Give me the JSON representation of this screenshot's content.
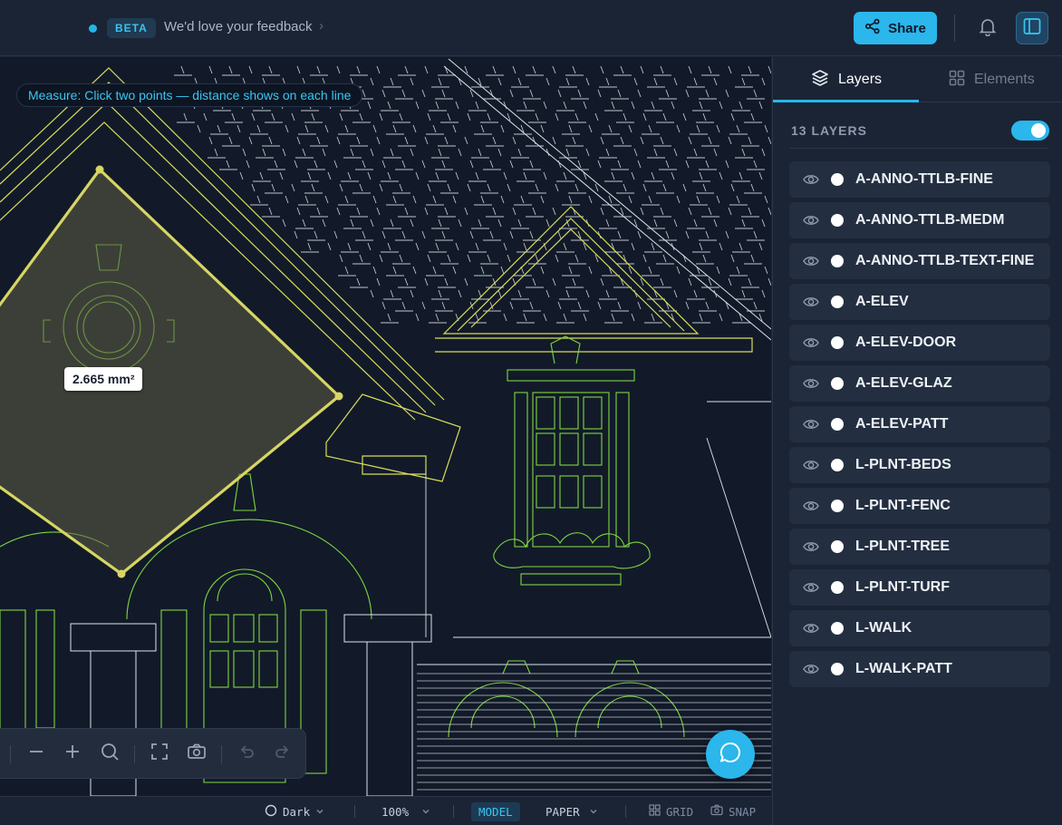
{
  "header": {
    "beta_badge": "BETA",
    "feedback_text": "We'd love your feedback",
    "feedback_chevron": "›",
    "share_label": "Share",
    "icons": {
      "share": "share-icon",
      "bell": "bell-icon",
      "panel": "panel-toggle-icon"
    },
    "colors": {
      "accent": "#2bb6ec"
    }
  },
  "canvas": {
    "measure_hint": "Measure: Click two points — distance shows on each line",
    "area_label": "2.665 mm²",
    "drawing_colors": {
      "lines": "#e6e6e6",
      "green": "#7fd640",
      "yellow": "#d8dc5a",
      "measure": "#d7d563"
    },
    "toolbar_icons": [
      "zoom-out-icon",
      "zoom-in-icon",
      "search-icon",
      "fit-screen-icon",
      "camera-icon",
      "undo-icon",
      "redo-icon"
    ]
  },
  "statusbar": {
    "theme": "Dark",
    "zoom": "100%",
    "model": "MODEL",
    "paper": "PAPER",
    "grid": "GRID",
    "snap": "SNAP"
  },
  "panel": {
    "tabs": [
      {
        "label": "Layers",
        "icon": "layers-icon",
        "active": true
      },
      {
        "label": "Elements",
        "icon": "grid-icon",
        "active": false
      }
    ],
    "count_label": "13 LAYERS",
    "toggle_on": true,
    "layers": [
      "A-ANNO-TTLB-FINE",
      "A-ANNO-TTLB-MEDM",
      "A-ANNO-TTLB-TEXT-FINE",
      "A-ELEV",
      "A-ELEV-DOOR",
      "A-ELEV-GLAZ",
      "A-ELEV-PATT",
      "L-PLNT-BEDS",
      "L-PLNT-FENC",
      "L-PLNT-TREE",
      "L-PLNT-TURF",
      "L-WALK",
      "L-WALK-PATT"
    ]
  }
}
